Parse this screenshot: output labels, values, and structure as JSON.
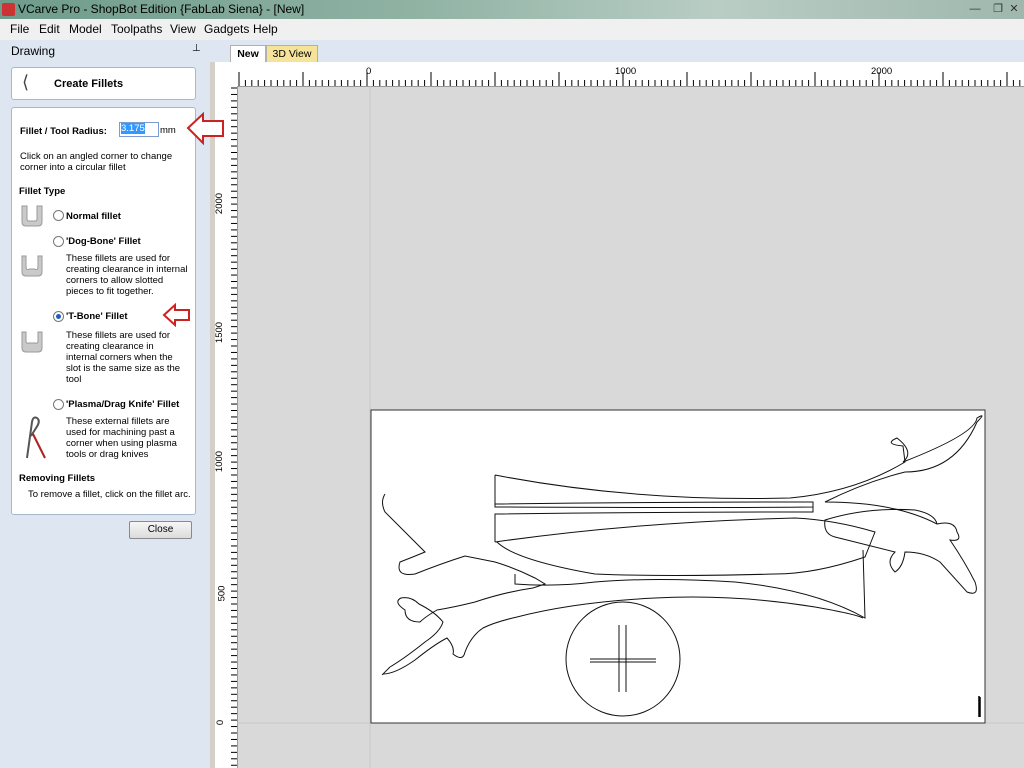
{
  "window": {
    "title": "VCarve Pro - ShopBot Edition {FabLab Siena} - [New]",
    "minimize": "—",
    "maximize": "❐",
    "close": "✕"
  },
  "menu": [
    "File",
    "Edit",
    "Model",
    "Toolpaths",
    "View",
    "Gadgets",
    "Help"
  ],
  "panel": {
    "header": "Drawing",
    "pin": "⊥",
    "title": "Create Fillets",
    "radius_label": "Fillet / Tool Radius:",
    "radius_value": "3.175",
    "radius_unit": "mm",
    "instructions": [
      "Click on an angled corner to change",
      "corner into a circular fillet"
    ],
    "fillet_type_heading": "Fillet Type",
    "options": [
      {
        "label": "Normal fillet",
        "selected": false,
        "icon": "normal-fillet-icon",
        "desc": []
      },
      {
        "label": "'Dog-Bone' Fillet",
        "selected": false,
        "icon": "dog-bone-fillet-icon",
        "desc": [
          "These fillets are used for",
          "creating clearance in internal",
          "corners to allow slotted",
          "pieces to fit together."
        ]
      },
      {
        "label": "'T-Bone' Fillet",
        "selected": true,
        "icon": "t-bone-fillet-icon",
        "desc": [
          "These fillets are used for",
          "creating clearance in",
          "internal corners when the",
          "slot is the same size as the",
          "tool"
        ]
      },
      {
        "label": "'Plasma/Drag Knife' Fillet",
        "selected": false,
        "icon": "plasma-fillet-icon",
        "desc": [
          "These external fillets are",
          "used for machining past a",
          "corner when using plasma",
          "tools or drag knives"
        ]
      }
    ],
    "removing_heading": "Removing Fillets",
    "removing_text": "To remove a fillet, click on the fillet arc.",
    "close": "Close"
  },
  "tabs": [
    {
      "label": "New",
      "active": true
    },
    {
      "label": "3D View",
      "active": false
    }
  ],
  "ruler": {
    "h_labels": [
      "0",
      "1000",
      "2000"
    ],
    "v_labels": [
      "2000",
      "1500",
      "1000",
      "500",
      "0"
    ]
  },
  "colors": {
    "panel_bg": "#dde6f1",
    "canvas_bg": "#d9d9d9",
    "annotation_arrow": "#cc2222",
    "tab_3d": "#f5e39a"
  }
}
